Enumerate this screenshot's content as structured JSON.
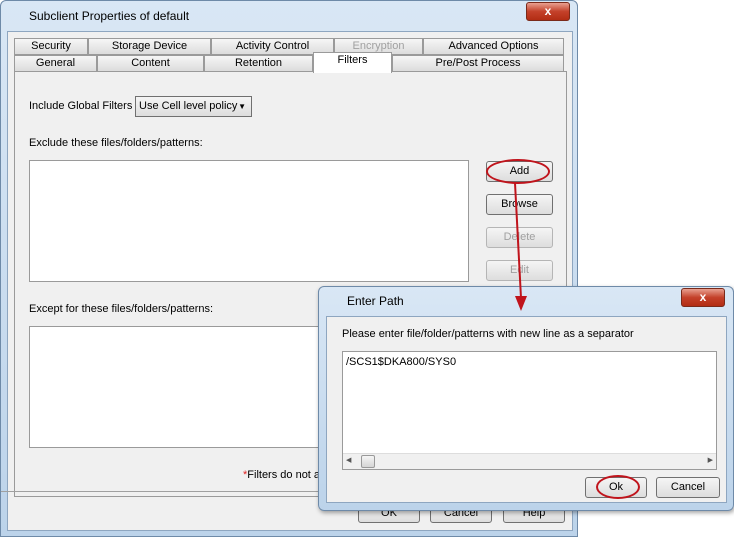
{
  "main_window": {
    "title": "Subclient Properties of default",
    "close": "x",
    "tabs_row1": [
      {
        "label": "Security"
      },
      {
        "label": "Storage Device"
      },
      {
        "label": "Activity Control"
      },
      {
        "label": "Encryption",
        "disabled": true
      },
      {
        "label": "Advanced Options"
      }
    ],
    "tabs_row2": [
      {
        "label": "General"
      },
      {
        "label": "Content"
      },
      {
        "label": "Retention"
      },
      {
        "label": "Filters",
        "selected": true
      },
      {
        "label": "Pre/Post Process"
      }
    ],
    "include_global_filters_label": "Include Global Filters",
    "include_global_filters_value": "Use Cell level policy",
    "exclude_label": "Exclude these files/folders/patterns:",
    "except_label": "Except for these files/folders/patterns:",
    "buttons": {
      "add": "Add",
      "browse": "Browse",
      "delete": "Delete",
      "edit": "Edit"
    },
    "footnote_star": "*",
    "footnote": "Filters do not a",
    "footer": {
      "ok": "OK",
      "cancel": "Cancel",
      "help": "Help"
    }
  },
  "dialog": {
    "title": "Enter Path",
    "close": "x",
    "prompt": "Please enter file/folder/patterns with new line as a separator",
    "value": "/SCS1$DKA800/SYS0",
    "ok": "Ok",
    "cancel": "Cancel"
  },
  "annotation_color": "#c0141c"
}
